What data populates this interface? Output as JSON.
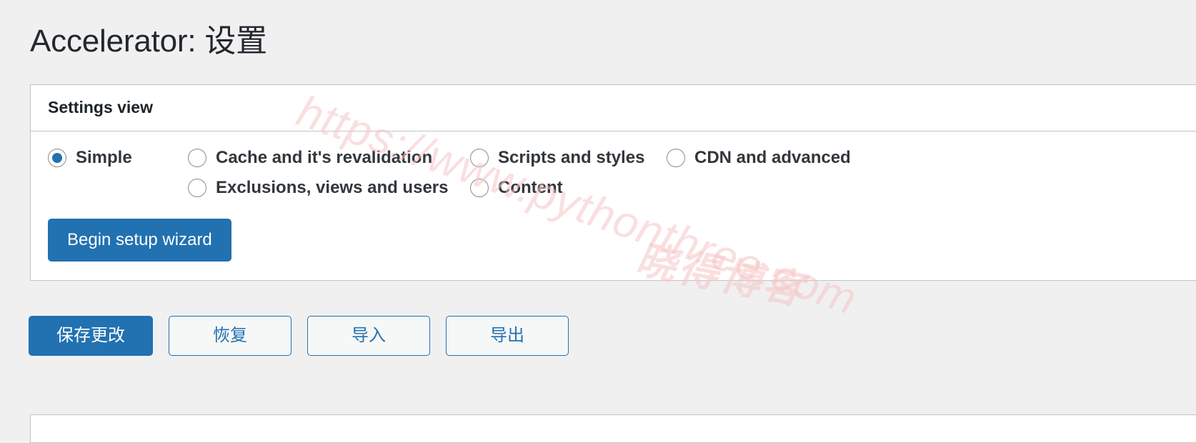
{
  "page": {
    "title": "Accelerator: 设置",
    "background_color": "#f0f0f1",
    "accent_color": "#2271b1"
  },
  "watermark": {
    "url_text": "https://www.pythonthree.com",
    "brand_text": "晓得博客",
    "color": "#f6c6c6"
  },
  "settings_card": {
    "header_title": "Settings view",
    "selected_view": "Simple",
    "view_options": [
      {
        "label": "Simple",
        "checked": true
      },
      {
        "label": "Cache and it's revalidation",
        "checked": false
      },
      {
        "label": "Scripts and styles",
        "checked": false
      },
      {
        "label": "CDN and advanced",
        "checked": false
      },
      {
        "label": "Exclusions, views and users",
        "checked": false
      },
      {
        "label": "Content",
        "checked": false
      }
    ],
    "wizard_button_label": "Begin setup wizard"
  },
  "action_bar": {
    "save_label": "保存更改",
    "restore_label": "恢复",
    "import_label": "导入",
    "export_label": "导出"
  }
}
